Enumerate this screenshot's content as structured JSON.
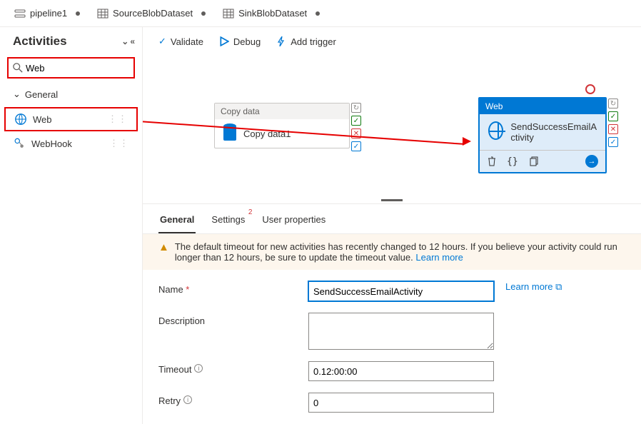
{
  "tabs": [
    {
      "label": "pipeline1",
      "icon": "pipeline"
    },
    {
      "label": "SourceBlobDataset",
      "icon": "dataset"
    },
    {
      "label": "SinkBlobDataset",
      "icon": "dataset"
    }
  ],
  "sidebar": {
    "title": "Activities",
    "search_value": "Web",
    "group": "General",
    "items": [
      {
        "label": "Web"
      },
      {
        "label": "WebHook"
      }
    ]
  },
  "toolbar": {
    "validate": "Validate",
    "debug": "Debug",
    "add_trigger": "Add trigger"
  },
  "canvas": {
    "copy": {
      "header": "Copy data",
      "label": "Copy data1"
    },
    "web": {
      "header": "Web",
      "label": "SendSuccessEmailActivity"
    }
  },
  "subtabs": {
    "general": "General",
    "settings": "Settings",
    "settings_badge": "2",
    "user_props": "User properties"
  },
  "warning": {
    "text": "The default timeout for new activities has recently changed to 12 hours. If you believe your activity could run longer than 12 hours, be sure to update the timeout value. ",
    "link": "Learn more"
  },
  "form": {
    "name_label": "Name ",
    "name_value": "SendSuccessEmailActivity",
    "learn_more": "Learn more",
    "desc_label": "Description",
    "desc_value": "",
    "timeout_label": "Timeout",
    "timeout_value": "0.12:00:00",
    "retry_label": "Retry",
    "retry_value": "0"
  }
}
